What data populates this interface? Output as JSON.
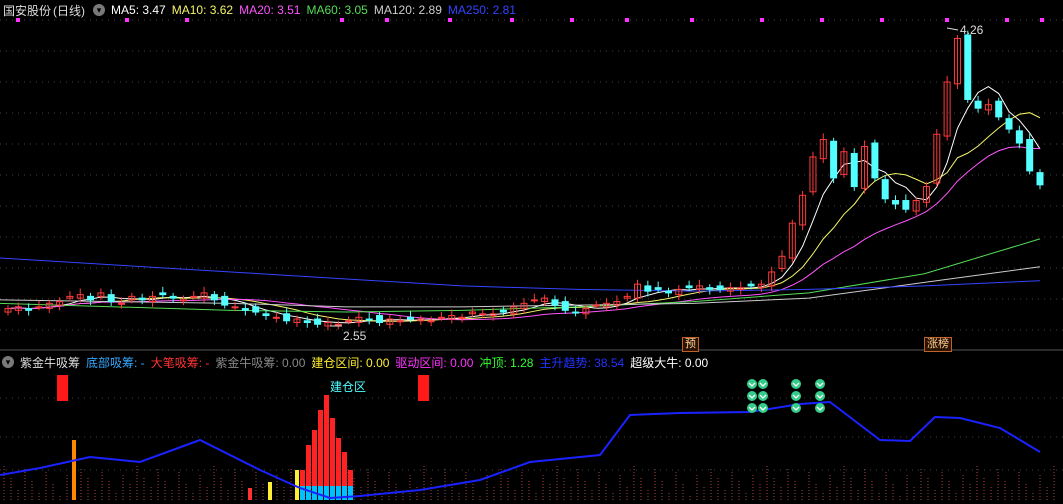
{
  "header": {
    "stock_name": "国安股份",
    "period": "(日线)",
    "ma": [
      {
        "label": "MA5",
        "value": "3.47",
        "color": "#ffffff"
      },
      {
        "label": "MA10",
        "value": "3.62",
        "color": "#f5f56a"
      },
      {
        "label": "MA20",
        "value": "3.51",
        "color": "#ff55ff"
      },
      {
        "label": "MA60",
        "value": "3.05",
        "color": "#55dd55"
      },
      {
        "label": "MA120",
        "value": "2.89",
        "color": "#cccccc"
      },
      {
        "label": "MA250",
        "value": "2.81",
        "color": "#3344ff"
      }
    ]
  },
  "price_chart": {
    "high_marker": "4.26",
    "low_marker": "2.55",
    "high_value": 4.26,
    "low_value": 2.55,
    "colors": {
      "up": "#ff3b3b",
      "down": "#54ffff",
      "ma5": "#ffffff",
      "ma10": "#f5f56a",
      "ma20": "#ff55ff",
      "ma60": "#55dd55",
      "ma120": "#cccccc",
      "ma250": "#3344ff",
      "grid": "#444444"
    },
    "badges": [
      {
        "text": "预"
      },
      {
        "text": "涨榜"
      }
    ]
  },
  "indicator": {
    "name": "紫金牛吸筹",
    "items": [
      {
        "label": "底部吸筹:",
        "value": " -",
        "color": "#33aaff"
      },
      {
        "label": "大笔吸筹:",
        "value": " -",
        "color": "#ff3333"
      },
      {
        "label": "紫金牛吸筹:",
        "value": "0.00",
        "color": "#888888"
      },
      {
        "label": "建仓区间:",
        "value": "0.00",
        "color": "#ffee33"
      },
      {
        "label": "驱动区间:",
        "value": "0.00",
        "color": "#ff33ff"
      },
      {
        "label": "冲顶:",
        "value": "1.28",
        "color": "#33ff33"
      },
      {
        "label": "主升趋势:",
        "value": "38.54",
        "color": "#2233ff"
      },
      {
        "label": "超级大牛:",
        "value": "0.00",
        "color": "#ffffff"
      }
    ],
    "zone_label": "建仓区"
  }
}
